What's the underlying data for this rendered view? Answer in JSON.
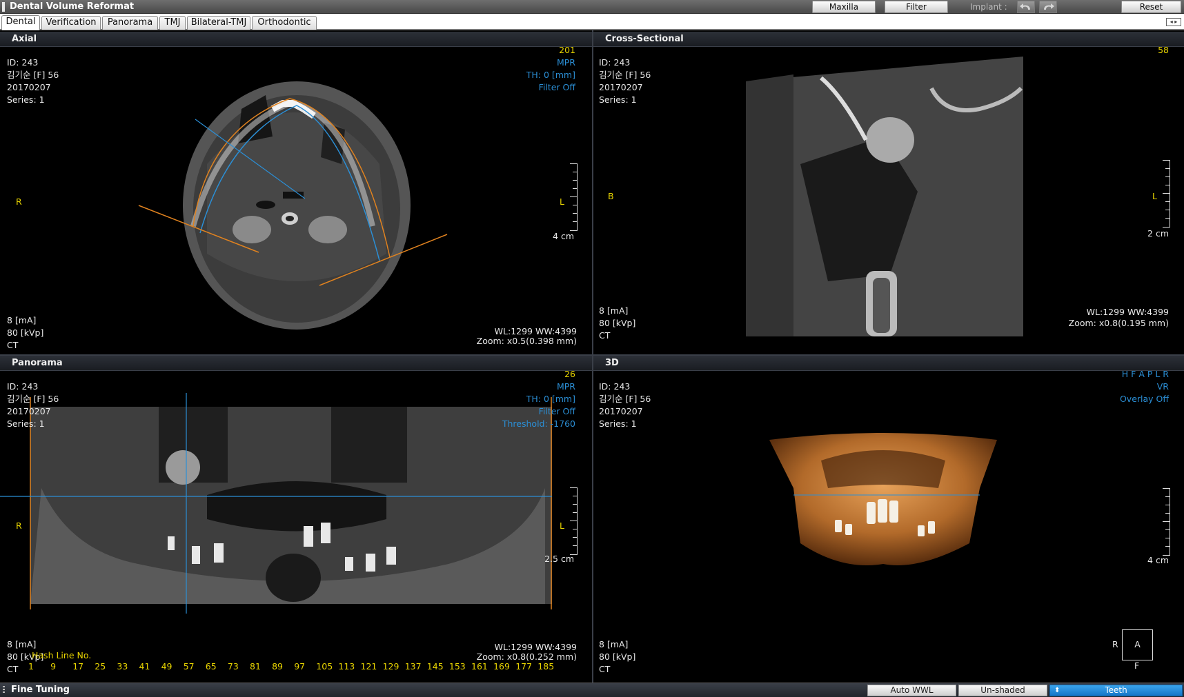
{
  "window": {
    "title": "Dental Volume Reformat",
    "buttons": {
      "maxilla": "Maxilla",
      "filter": "Filter",
      "reset": "Reset"
    },
    "implant_label": "Implant :"
  },
  "tabs": [
    {
      "label": "Dental",
      "active": true
    },
    {
      "label": "Verification"
    },
    {
      "label": "Panorama"
    },
    {
      "label": "TMJ"
    },
    {
      "label": "Bilateral-TMJ"
    },
    {
      "label": "Orthodontic"
    }
  ],
  "tab_scroll": "◂ ▸",
  "patient": {
    "id": "ID: 243",
    "name": "김기순 [F] 56",
    "date": "20170207",
    "series": "Series: 1"
  },
  "acquisition": {
    "ma": "8 [mA]",
    "kvp": "80 [kVp]",
    "modality": "CT"
  },
  "panes": {
    "axial": {
      "title": "Axial",
      "slice": "201",
      "mode": "MPR",
      "thickness": "TH: 0 [mm]",
      "filter": "Filter Off",
      "left_marker": "R",
      "right_marker": "L",
      "scale": "4 cm",
      "wlww": "WL:1299 WW:4399",
      "zoom": "Zoom: x0.5(0.398 mm)"
    },
    "cross": {
      "title": "Cross-Sectional",
      "slice": "58",
      "left_marker": "B",
      "right_marker": "L",
      "scale": "2 cm",
      "wlww": "WL:1299 WW:4399",
      "zoom": "Zoom: x0.8(0.195 mm)"
    },
    "panorama": {
      "title": "Panorama",
      "slice": "26",
      "mode": "MPR",
      "thickness": "TH: 0 [mm]",
      "filter": "Filter Off",
      "threshold": "Threshold: -1760",
      "left_marker": "R",
      "right_marker": "L",
      "scale": "2.5 cm",
      "wlww": "WL:1299 WW:4399",
      "zoom": "Zoom: x0.8(0.252 mm)",
      "hash_label": "Hash Line No.",
      "hash_numbers": [
        "1",
        "9",
        "17",
        "25",
        "33",
        "41",
        "49",
        "57",
        "65",
        "73",
        "81",
        "89",
        "97",
        "105",
        "113",
        "121",
        "129",
        "137",
        "145",
        "153",
        "161",
        "169",
        "177",
        "185"
      ]
    },
    "vr3d": {
      "title": "3D",
      "orient": "H F A P L R",
      "mode": "VR",
      "overlay": "Overlay Off",
      "scale": "4 cm",
      "cube_front": "A",
      "cube_left": "R",
      "cube_bottom": "F"
    }
  },
  "bottom": {
    "label": "Fine Tuning",
    "auto_wwl": "Auto WWL",
    "unshaded": "Un-shaded",
    "teeth": "Teeth"
  },
  "colors": {
    "overlay_blue": "#2b8fd6",
    "overlay_yellow": "#e8d400",
    "curve_orange": "#e0821f",
    "teeth_button": "#1f8ddc"
  }
}
